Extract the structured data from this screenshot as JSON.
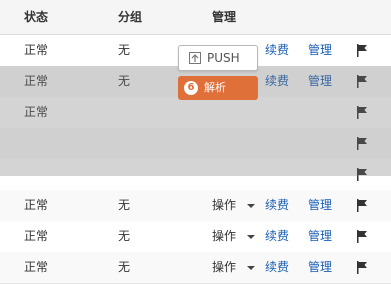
{
  "columns": {
    "status": "状态",
    "group": "分组",
    "manage": "管理"
  },
  "rows": [
    {
      "status": "正常",
      "group": "无",
      "op": "",
      "renew": "续费",
      "manage": "管理"
    },
    {
      "status": "正常",
      "group": "无",
      "op": "",
      "renew": "续费",
      "manage": "管理"
    },
    {
      "status": "正常",
      "group": "",
      "op": "",
      "renew": "",
      "manage": ""
    },
    {
      "status": "",
      "group": "",
      "op": "",
      "renew": "",
      "manage": ""
    },
    {
      "status": "",
      "group": "",
      "op": "",
      "renew": "",
      "manage": ""
    },
    {
      "status": "正常",
      "group": "无",
      "op": "操作",
      "renew": "续费",
      "manage": "管理"
    },
    {
      "status": "正常",
      "group": "无",
      "op": "操作",
      "renew": "续费",
      "manage": "管理"
    },
    {
      "status": "正常",
      "group": "无",
      "op": "操作",
      "renew": "续费",
      "manage": "管理"
    }
  ],
  "push_button": {
    "label": "PUSH",
    "icon": "push-icon"
  },
  "orange_button": {
    "label": "解析",
    "icon": "circle-number-icon",
    "icon_text": "6",
    "color": "#e0703a"
  },
  "flag_icon": "flag-icon",
  "link_color": "#1a5fb4"
}
